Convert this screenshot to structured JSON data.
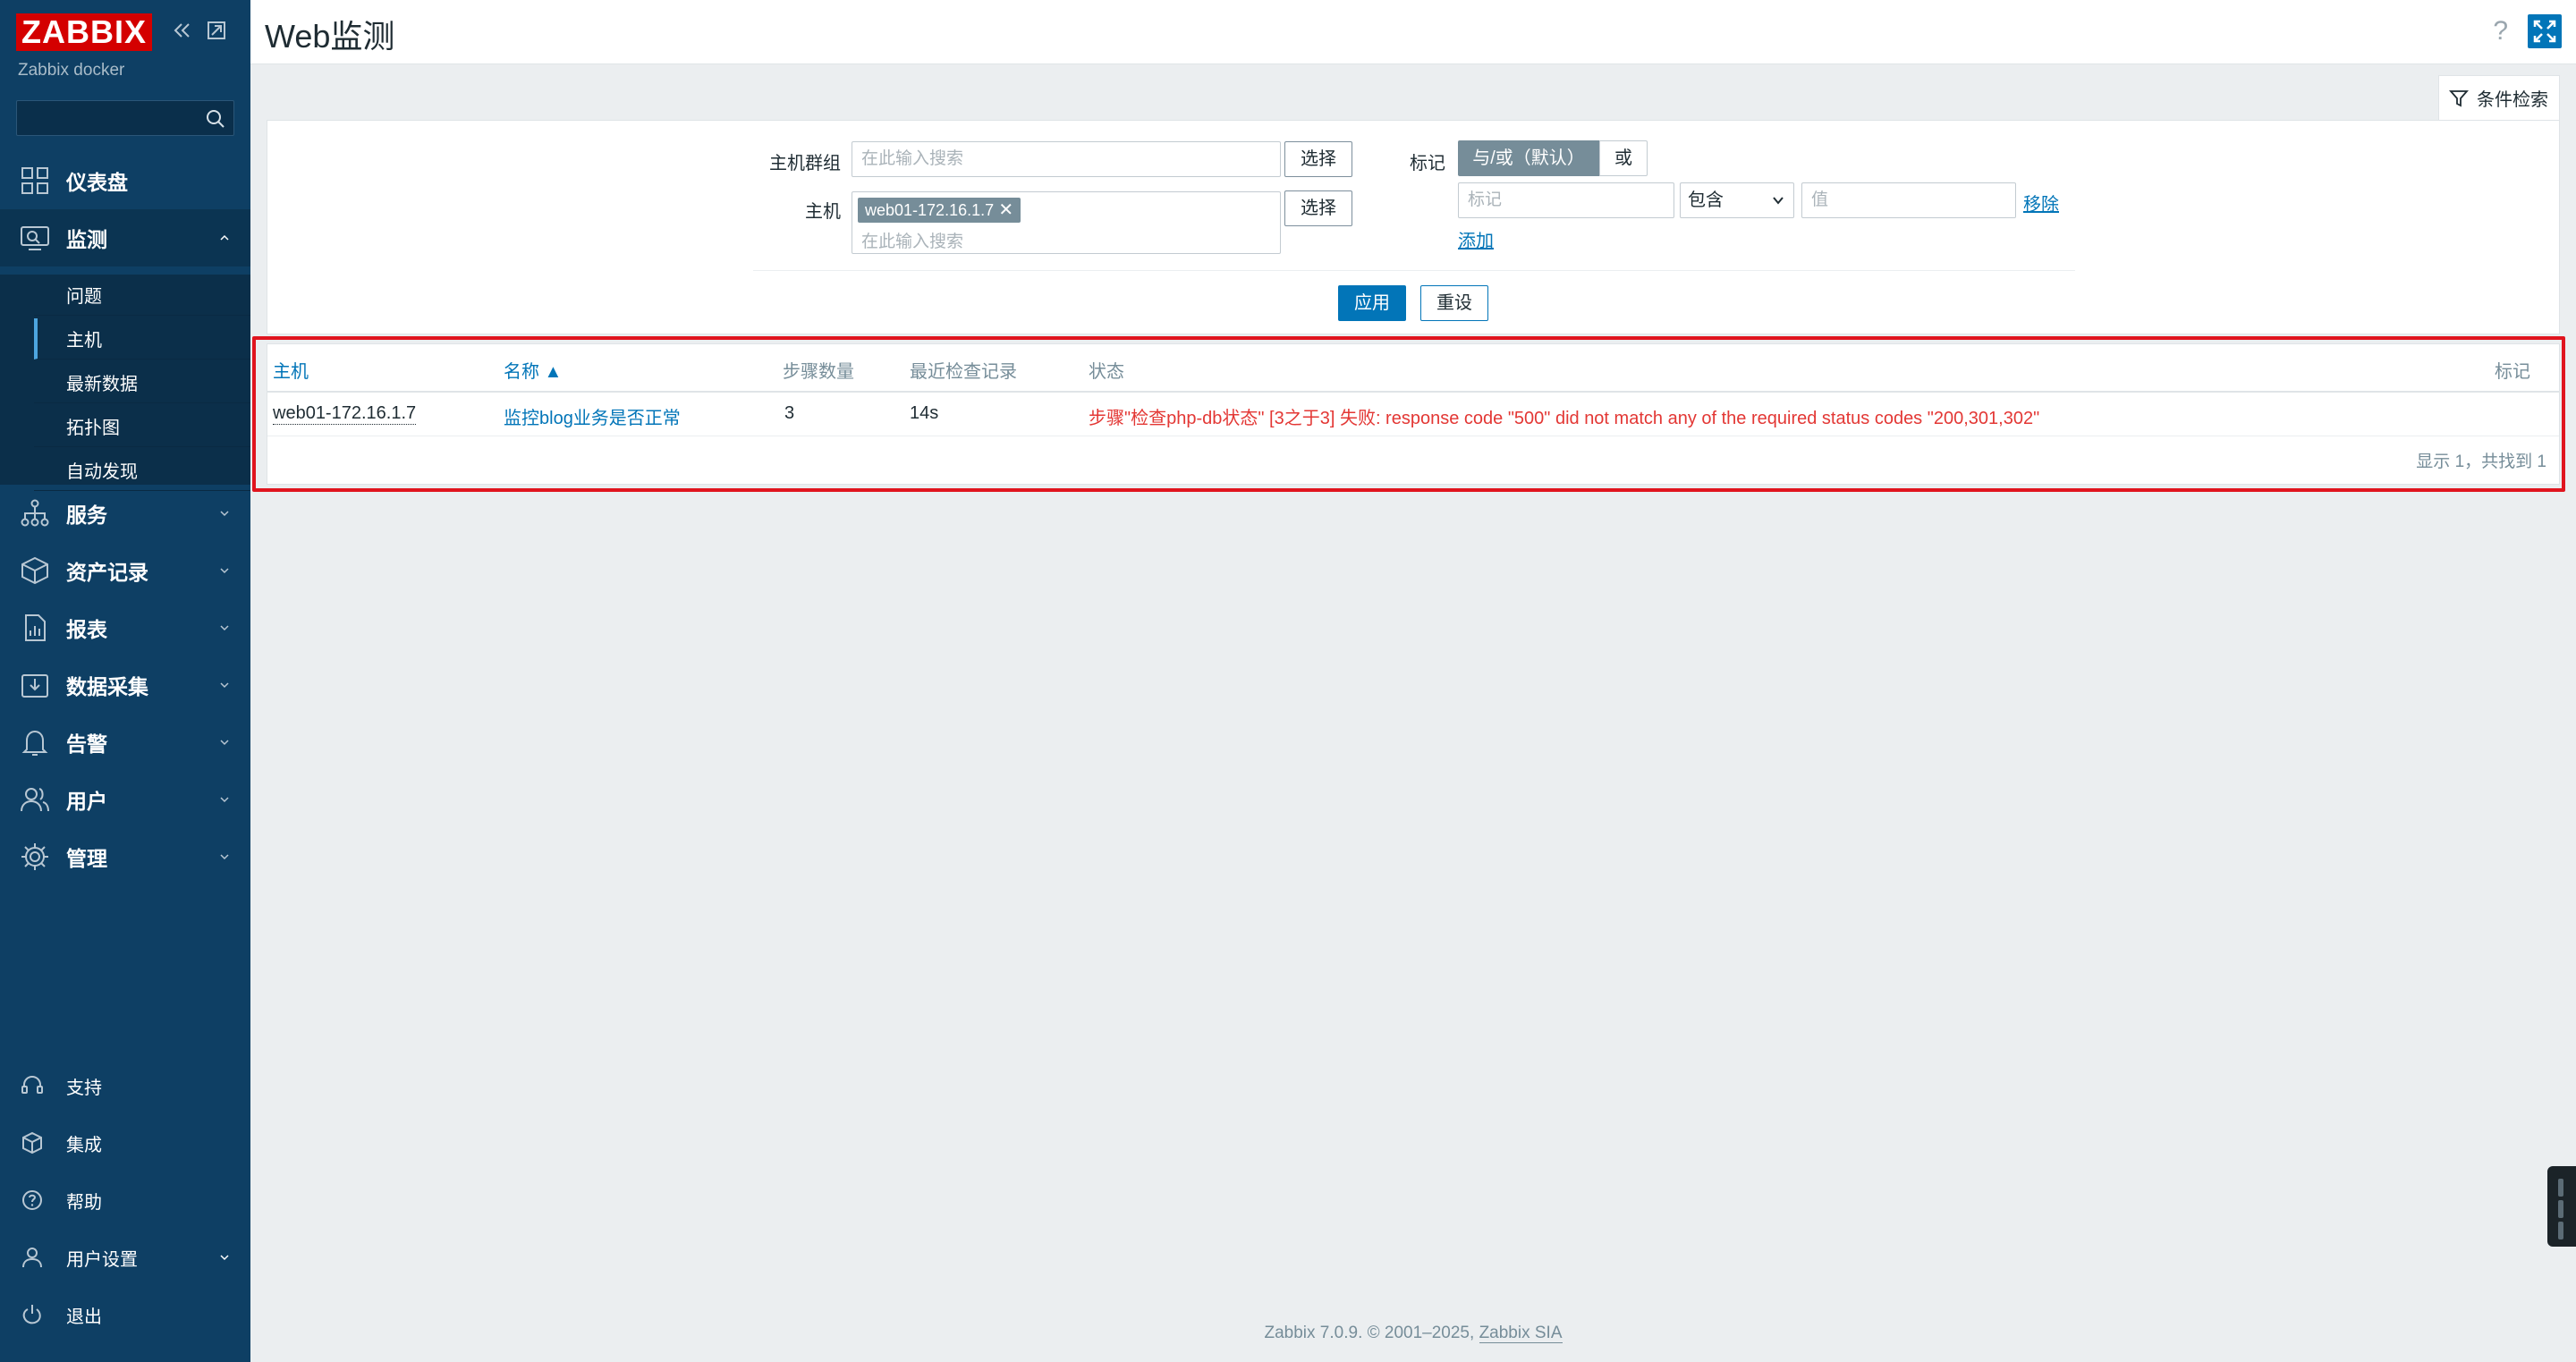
{
  "sidebar": {
    "logo": "ZABBIX",
    "server_name": "Zabbix docker",
    "collapse_icon": "double-chevron-left-icon",
    "kiosk_icon": "expand-window-icon",
    "search_placeholder": "",
    "menu": [
      {
        "label": "仪表盘",
        "icon": "dashboard-icon",
        "expandable": false
      },
      {
        "label": "监测",
        "icon": "monitoring-icon",
        "expandable": true,
        "expanded": true
      },
      {
        "label": "服务",
        "icon": "services-icon",
        "expandable": true
      },
      {
        "label": "资产记录",
        "icon": "inventory-icon",
        "expandable": true
      },
      {
        "label": "报表",
        "icon": "reports-icon",
        "expandable": true
      },
      {
        "label": "数据采集",
        "icon": "data-collection-icon",
        "expandable": true
      },
      {
        "label": "告警",
        "icon": "bell-icon",
        "expandable": true
      },
      {
        "label": "用户",
        "icon": "users-icon",
        "expandable": true
      },
      {
        "label": "管理",
        "icon": "gear-icon",
        "expandable": true
      }
    ],
    "submenu": [
      "问题",
      "主机",
      "最新数据",
      "拓扑图",
      "自动发现"
    ],
    "submenu_selected": "主机",
    "bottom": [
      {
        "label": "支持",
        "icon": "headset-icon"
      },
      {
        "label": "集成",
        "icon": "cube-icon"
      },
      {
        "label": "帮助",
        "icon": "question-icon"
      },
      {
        "label": "用户设置",
        "icon": "user-icon",
        "expandable": true
      },
      {
        "label": "退出",
        "icon": "power-icon"
      }
    ]
  },
  "header": {
    "title": "Web监测",
    "help": "?"
  },
  "filter": {
    "tab_label": "条件检索",
    "hostgroup_label": "主机群组",
    "hostgroup_placeholder": "在此输入搜索",
    "host_label": "主机",
    "host_chip": "web01-172.16.1.7",
    "host_placeholder": "在此输入搜索",
    "select_label": "选择",
    "tags_label": "标记",
    "tags_andor": "与/或（默认）",
    "tags_or": "或",
    "tag_placeholder": "标记",
    "tag_operator": "包含",
    "value_placeholder": "值",
    "remove_label": "移除",
    "add_label": "添加",
    "apply_label": "应用",
    "reset_label": "重设"
  },
  "table": {
    "columns": {
      "host": "主机",
      "name": "名称 ▲",
      "steps": "步骤数量",
      "last_check": "最近检查记录",
      "status": "状态",
      "tags": "标记"
    },
    "rows": [
      {
        "host": "web01-172.16.1.7",
        "name": "监控blog业务是否正常",
        "steps": "3",
        "last_check": "14s",
        "status": "步骤\"检查php-db状态\" [3之于3] 失败: response code \"500\" did not match any of the required status codes \"200,301,302\"",
        "tags": ""
      }
    ],
    "paging": "显示 1，共找到 1"
  },
  "footer": {
    "text": "Zabbix 7.0.9. © 2001–2025, ",
    "company": "Zabbix SIA"
  },
  "colors": {
    "sidebar_bg": "#0e3f64",
    "accent": "#0275b8",
    "error": "#e33734",
    "logo_red": "#d40000",
    "highlight_box": "#e0141e"
  }
}
